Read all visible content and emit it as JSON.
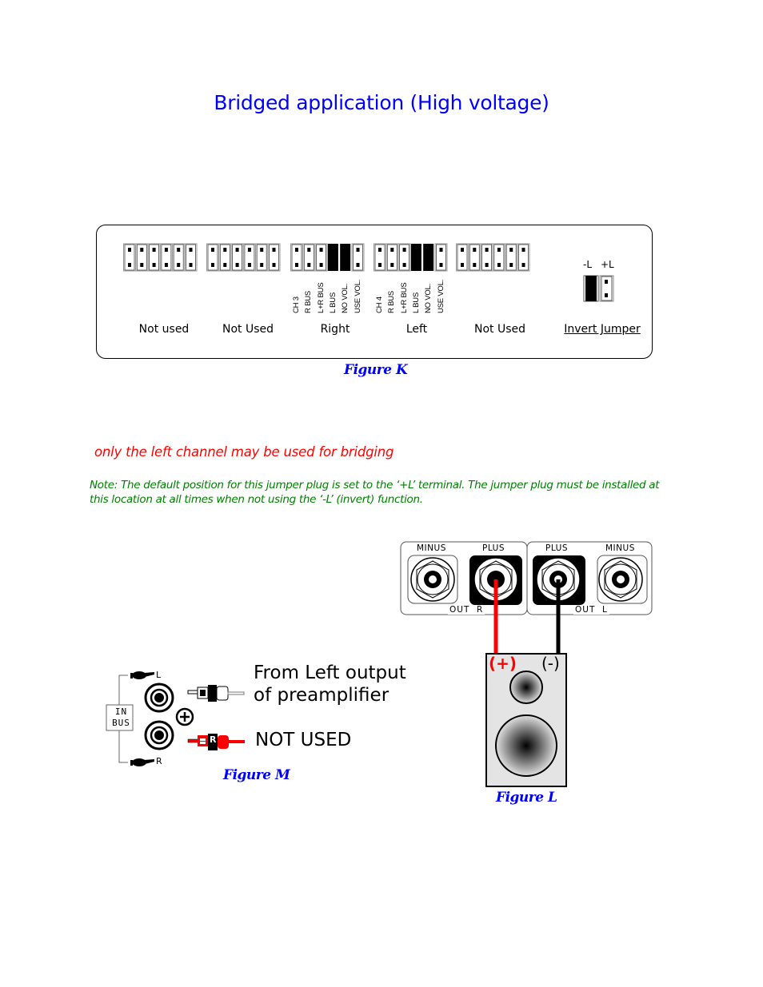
{
  "title": "Bridged application (High voltage)",
  "figure_k": {
    "caption": "Figure K",
    "groups": [
      {
        "label": "Not used",
        "jumpers_installed": [
          false,
          false,
          false,
          false,
          false,
          false
        ],
        "pin_labels": []
      },
      {
        "label": "Not Used",
        "jumpers_installed": [
          false,
          false,
          false,
          false,
          false,
          false
        ],
        "pin_labels": []
      },
      {
        "label": "Right",
        "jumpers_installed": [
          false,
          false,
          false,
          true,
          true,
          false
        ],
        "pin_labels": [
          "CH  3",
          "R BUS",
          "L+R BUS",
          "L BUS",
          "NO VOL.",
          "USE VOL."
        ]
      },
      {
        "label": "Left",
        "jumpers_installed": [
          false,
          false,
          false,
          true,
          true,
          false
        ],
        "pin_labels": [
          "CH  4",
          "R BUS",
          "L+R BUS",
          "L BUS",
          "NO VOL.",
          "USE VOL."
        ]
      },
      {
        "label": "Not Used",
        "jumpers_installed": [
          false,
          false,
          false,
          false,
          false,
          false
        ],
        "pin_labels": []
      }
    ],
    "invert_jumper": {
      "label": "Invert Jumper",
      "terminals": [
        "-L",
        "+L"
      ],
      "jumpers_installed": [
        true,
        false
      ]
    }
  },
  "warning": "only the left channel may be used for bridging",
  "note": "Note: The default position for this jumper plug is set to the ‘+L’ terminal.  The jumper plug must be installed at this location at all times when not using the ‘-L’ (invert) function.",
  "figure_l": {
    "caption": "Figure L",
    "outputs": [
      {
        "group": "OUT  R",
        "terminals": [
          "MINUS",
          "PLUS"
        ]
      },
      {
        "group": "OUT  L",
        "terminals": [
          "PLUS",
          "MINUS"
        ]
      }
    ],
    "speaker_plus": "(+)",
    "speaker_minus": "(-)",
    "colors": {
      "plus_wire": "#ff0000",
      "minus_wire": "#000000"
    }
  },
  "figure_m": {
    "caption": "Figure M",
    "in_bus_label_1": "IN",
    "in_bus_label_2": "BUS",
    "jack_l": "L",
    "jack_r": "R",
    "plug_r_letter": "R",
    "text_left_1": "From Left output",
    "text_left_2": "of preamplifier",
    "text_right": "NOT USED"
  }
}
